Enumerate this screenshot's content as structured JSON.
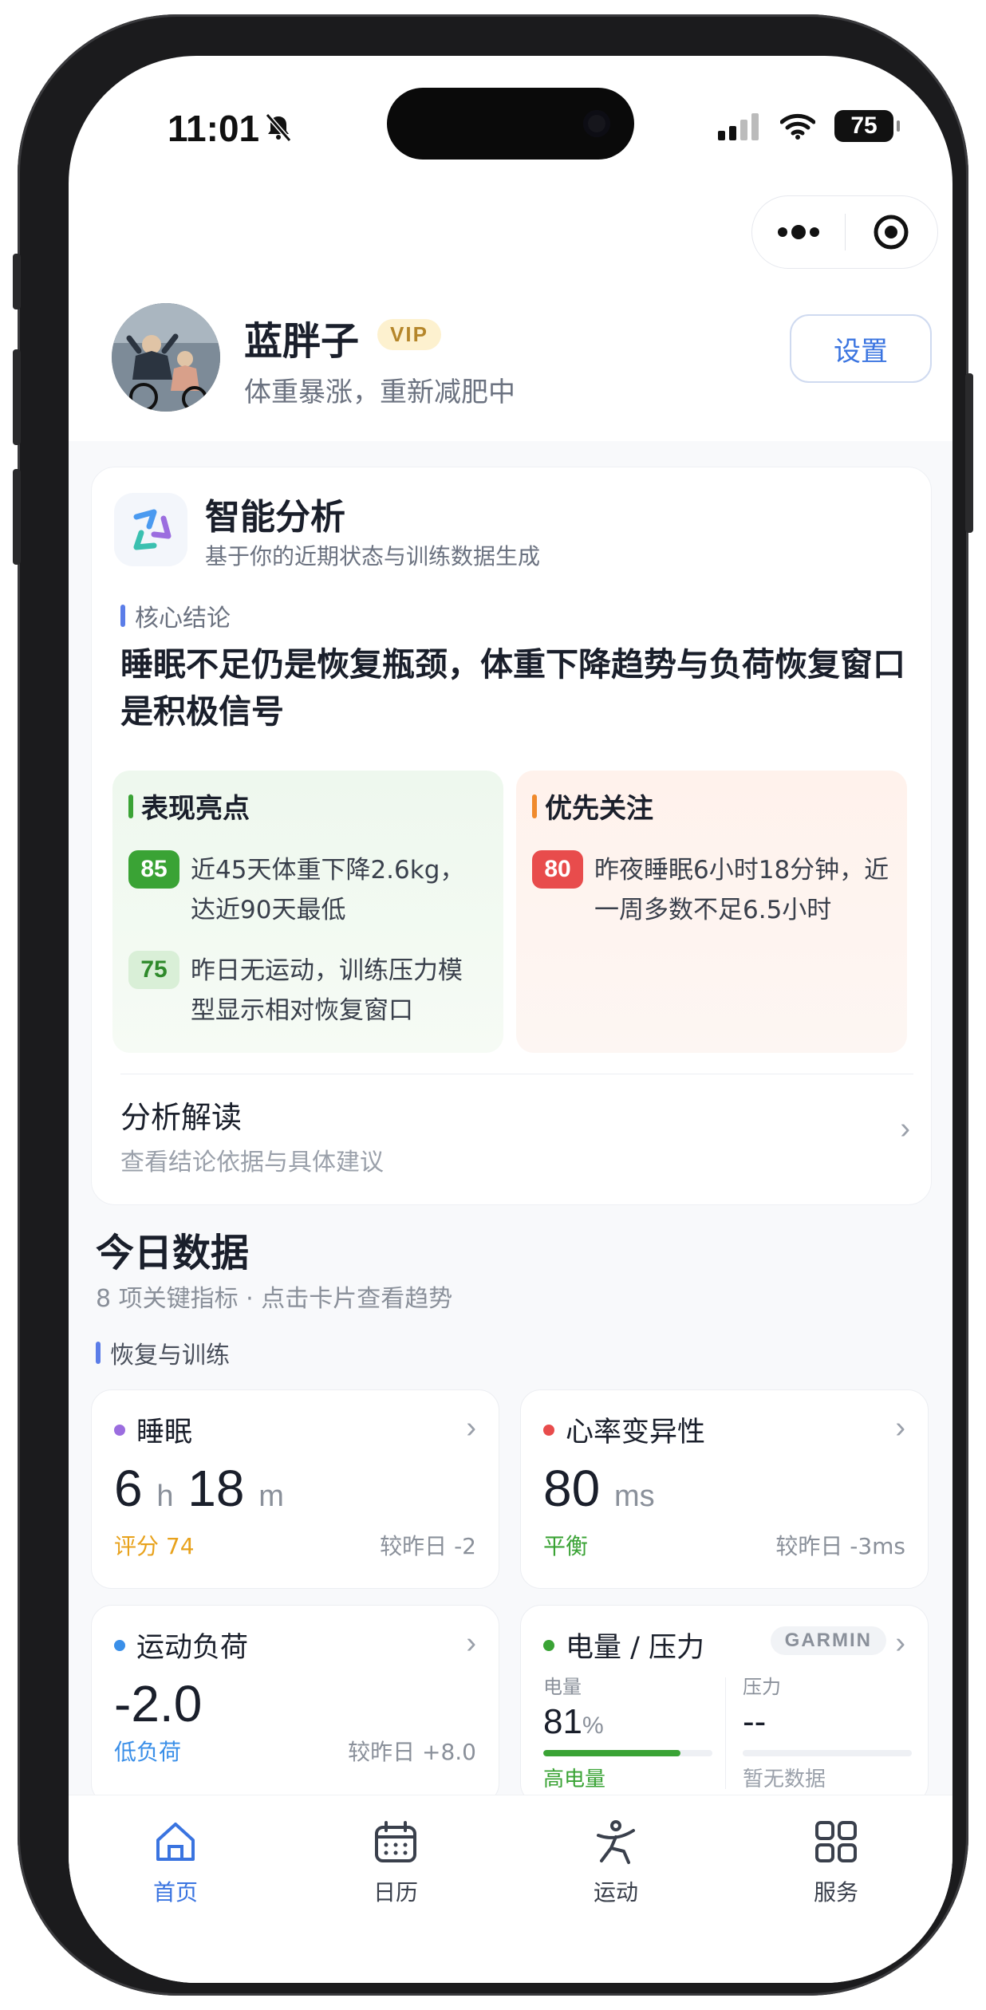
{
  "status": {
    "time": "11:01",
    "battery": "75"
  },
  "profile": {
    "name": "蓝胖子",
    "vip": "VIP",
    "subtitle": "体重暴涨，重新减肥中",
    "settings_label": "设置"
  },
  "analysis": {
    "title": "智能分析",
    "subtitle": "基于你的近期状态与训练数据生成",
    "core_label": "核心结论",
    "conclusion": "睡眠不足仍是恢复瓶颈，体重下降趋势与负荷恢复窗口是积极信号",
    "highlights": {
      "title": "表现亮点",
      "items": [
        {
          "score": "85",
          "text": "近45天体重下降2.6kg，达近90天最低"
        },
        {
          "score": "75",
          "text": "昨日无运动，训练压力模型显示相对恢复窗口"
        }
      ]
    },
    "focus": {
      "title": "优先关注",
      "items": [
        {
          "score": "80",
          "text": "昨夜睡眠6小时18分钟，近一周多数不足6.5小时"
        }
      ]
    },
    "interpretation": {
      "title": "分析解读",
      "subtitle": "查看结论依据与具体建议"
    }
  },
  "today": {
    "title": "今日数据",
    "subtitle": "8 项关键指标 · 点击卡片查看趋势",
    "group_label": "恢复与训练",
    "sleep": {
      "title": "睡眠",
      "hours": "6",
      "h_unit": "h",
      "minutes": "18",
      "m_unit": "m",
      "score": "评分 74",
      "compare": "较昨日 -2",
      "dot_color": "#9b6ddf"
    },
    "hrv": {
      "title": "心率变异性",
      "value": "80",
      "unit": "ms",
      "status": "平衡",
      "compare": "较昨日 -3ms",
      "dot_color": "#e84c4c"
    },
    "load": {
      "title": "运动负荷",
      "value": "-2.0",
      "status": "低负荷",
      "compare": "较昨日 +8.0",
      "dot_color": "#3a8fe8"
    },
    "energy": {
      "title": "电量 / 压力",
      "brand": "GARMIN",
      "dot_color": "#3aa335",
      "battery_label": "电量",
      "battery_value": "81",
      "battery_unit": "%",
      "battery_fill": 0.81,
      "battery_status": "高电量",
      "stress_label": "压力",
      "stress_value": "--",
      "stress_status": "暂无数据"
    }
  },
  "tabs": [
    {
      "label": "首页",
      "icon": "home-icon"
    },
    {
      "label": "日历",
      "icon": "calendar-icon"
    },
    {
      "label": "运动",
      "icon": "exercise-icon"
    },
    {
      "label": "服务",
      "icon": "grid-icon"
    }
  ],
  "colors": {
    "accent": "#3a74e0",
    "green": "#3aa335",
    "orange": "#f08a2c",
    "red": "#e84c4c"
  }
}
